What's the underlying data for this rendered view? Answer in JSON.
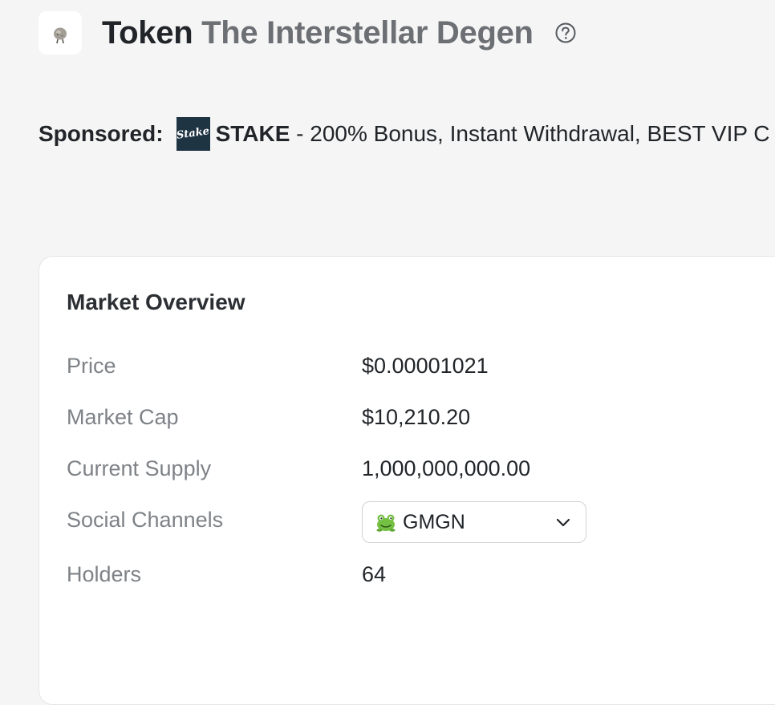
{
  "header": {
    "title_prefix": "Token",
    "token_name": "The Interstellar Degen",
    "avatar_icon": "rocky-creature-icon",
    "help_icon": "question-circle-icon"
  },
  "sponsored": {
    "label": "Sponsored:",
    "logo_text": "Stake",
    "name": "STAKE",
    "text": " - 200% Bonus, Instant Withdrawal, BEST VIP C"
  },
  "market_overview": {
    "title": "Market Overview",
    "rows": [
      {
        "label": "Price",
        "value": "$0.00001021"
      },
      {
        "label": "Market Cap",
        "value": "$10,210.20"
      },
      {
        "label": "Current Supply",
        "value": "1,000,000,000.00"
      },
      {
        "label": "Social Channels",
        "value": "GMGN"
      },
      {
        "label": "Holders",
        "value": "64"
      }
    ],
    "social_dropdown": {
      "selected": "GMGN",
      "icon": "frog-icon"
    }
  },
  "colors": {
    "background": "#f5f5f5",
    "card": "#ffffff",
    "stake_logo": "#1f3443",
    "muted_label": "#7e8287",
    "title_name": "#6c6f73"
  }
}
